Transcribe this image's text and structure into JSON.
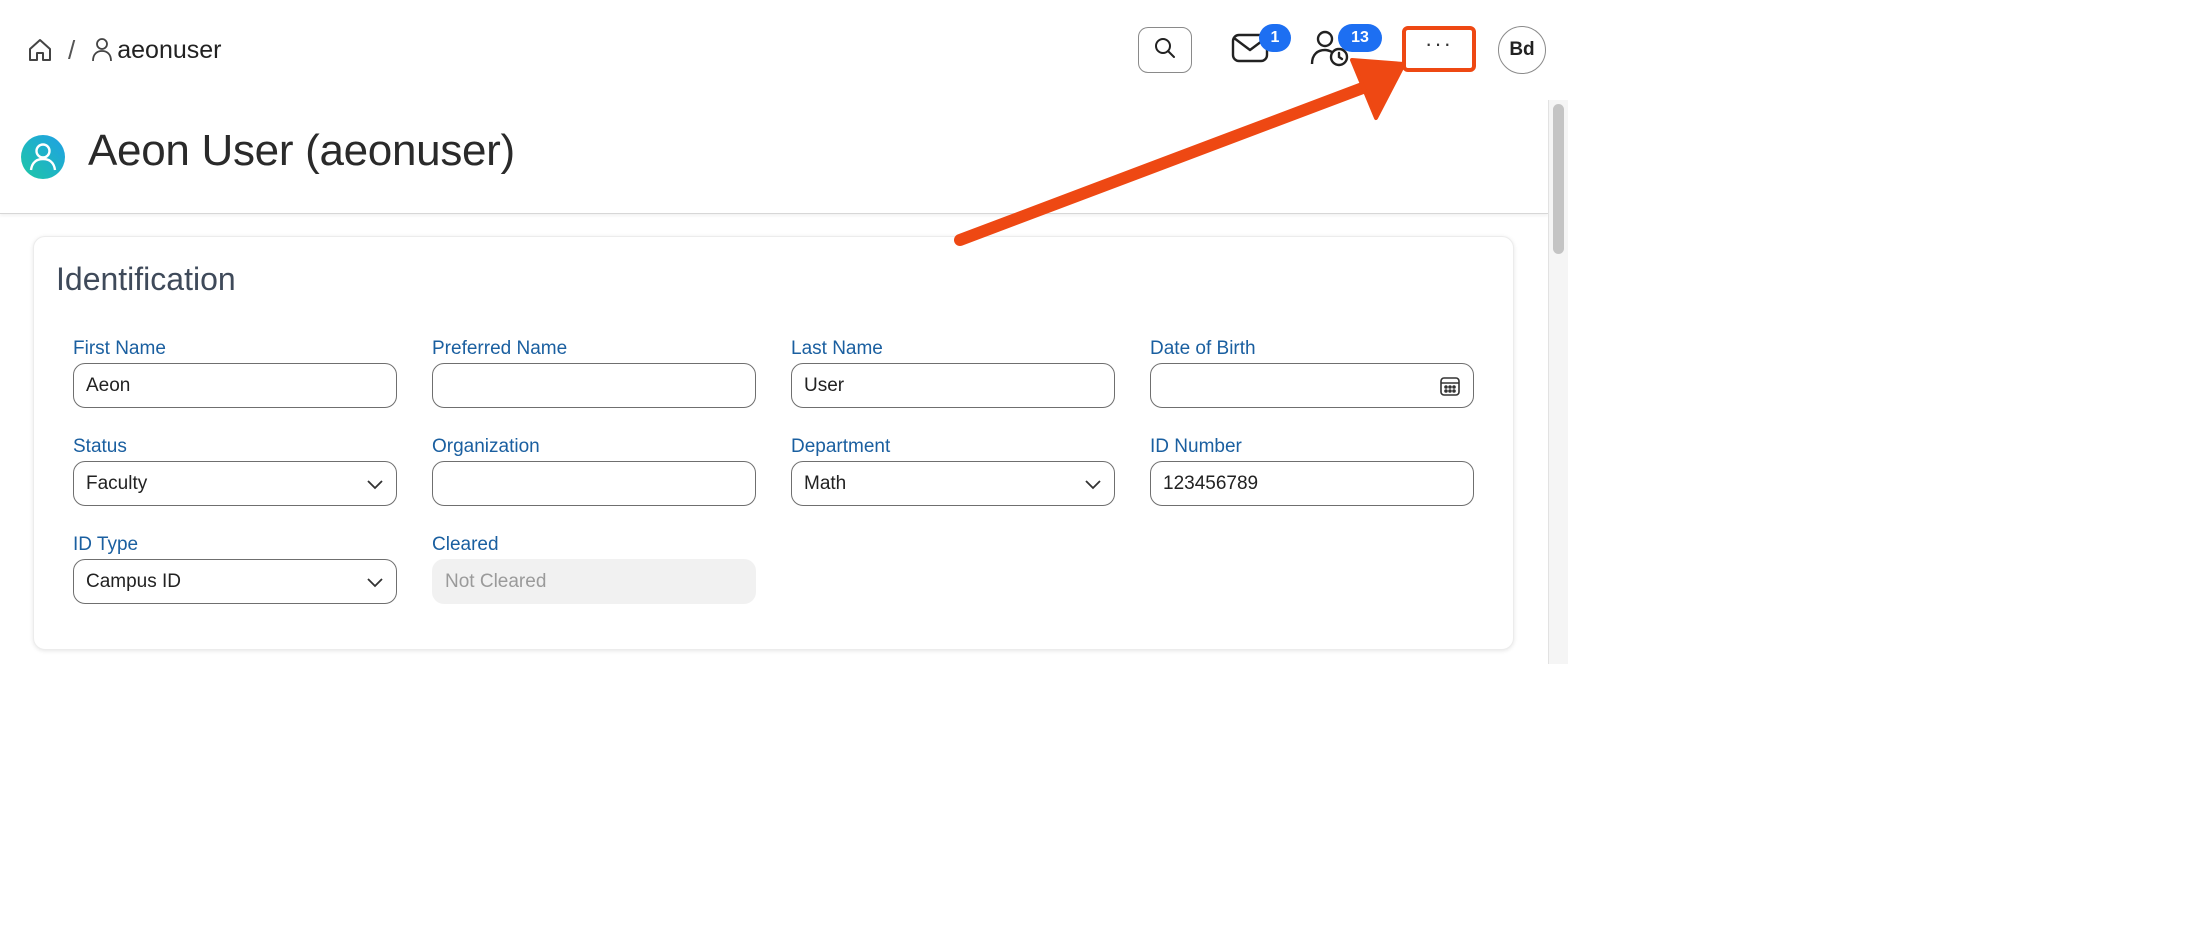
{
  "breadcrumb": {
    "separator": "/",
    "current": "aeonuser"
  },
  "toolbar": {
    "mail_count": "1",
    "notifications_count": "13",
    "more_label": "···",
    "avatar_initials": "Bd"
  },
  "header": {
    "title": "Aeon User (aeonuser)"
  },
  "identification": {
    "title": "Identification",
    "fields": [
      {
        "label": "First Name",
        "value": "Aeon",
        "type": "text"
      },
      {
        "label": "Preferred Name",
        "value": "",
        "type": "text"
      },
      {
        "label": "Last Name",
        "value": "User",
        "type": "text"
      },
      {
        "label": "Date of Birth",
        "value": "",
        "type": "date"
      },
      {
        "label": "Status",
        "value": "Faculty",
        "type": "select"
      },
      {
        "label": "Organization",
        "value": "",
        "type": "text"
      },
      {
        "label": "Department",
        "value": "Math",
        "type": "select"
      },
      {
        "label": "ID Number",
        "value": "123456789",
        "type": "text"
      },
      {
        "label": "ID Type",
        "value": "Campus ID",
        "type": "select"
      },
      {
        "label": "Cleared",
        "value": "Not Cleared",
        "type": "readonly"
      }
    ]
  },
  "colors": {
    "accent_label": "#1a5fa0",
    "badge": "#1d6ff2",
    "annotation": "#ee4813",
    "user_icon_gradient": [
      "#1ec8a5",
      "#1f9fe6"
    ]
  },
  "icons": {
    "home": "home-icon",
    "user": "user-icon",
    "search": "search-icon",
    "mail": "mail-icon",
    "people": "user-clock-icon",
    "calendar": "calendar-icon",
    "chevron": "chevron-down-icon"
  }
}
